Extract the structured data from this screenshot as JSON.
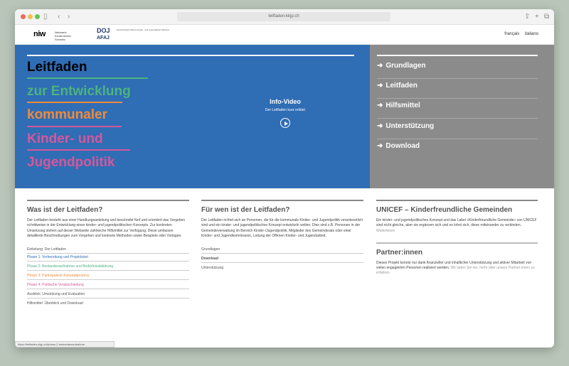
{
  "browser": {
    "url": "leitfaden-kkjp.ch",
    "icons": [
      "sidebar-icon",
      "back-icon",
      "forward-icon",
      "share-icon",
      "new-tab-icon",
      "tabs-icon"
    ]
  },
  "header": {
    "logo_niw": "niw",
    "logo_niw_text": "Netzwerk Kinderrechte Schweiz",
    "logo_doj": "DOJ",
    "logo_doj_sub": "AFAJ",
    "logo_doj_text": "Dachverband Offene Kinder- und Jugendarbeit Schweiz",
    "languages": [
      "français",
      "italiano"
    ]
  },
  "hero": {
    "title_lines": [
      {
        "text": "Leitfaden",
        "color": "#ffffff"
      },
      {
        "text": "zur Entwicklung",
        "color": "#4db37e"
      },
      {
        "text": "kommunaler",
        "color": "#f08a3c"
      },
      {
        "text": "Kinder- und",
        "color": "#d4589a"
      },
      {
        "text": "Jugendpolitik",
        "color": "#d4589a"
      }
    ],
    "video_title": "Info-Video",
    "video_sub": "Der Leitfaden kurz erklärt"
  },
  "nav": {
    "items": [
      "Grundlagen",
      "Leitfaden",
      "Hilfsmittel",
      "Unterstützung",
      "Download"
    ]
  },
  "col1": {
    "heading": "Was ist der Leitfaden?",
    "body": "Der Leitfaden besteht aus einer Handlungsanleitung und beschreibt fünf und orientiert das Vorgehen schrittweise in der Entwicklung eines kinder- und jugendpolitischen Konzepts. Zur konkreten Umsetzung stehen auf dieser Webseite zahlreiche Hilfsmittel zur Verfügung. Diese umfassen detaillierte Beschreibungen zum Vorgehen und konkrete Methoden sowie Beispiele oder Vorlagen.",
    "links": [
      {
        "text": "Einleitung: Der Leitfaden",
        "color": "#555555"
      },
      {
        "text": "Phase 1: Vorbereitung und Projektstart",
        "color": "#2f6db5"
      },
      {
        "text": "Phase 2: Bestandesaufnahme und Bedürfnisabklärung",
        "color": "#4db37e"
      },
      {
        "text": "Phase 3: Partizipativer Konzeptprozess",
        "color": "#f08a3c"
      },
      {
        "text": "Phase 4: Politische Verabschiedung",
        "color": "#d4589a"
      },
      {
        "text": "Ausblick: Umsetzung und Evaluation",
        "color": "#555555"
      },
      {
        "text": "Hilfsmittel: Überblick und Download",
        "color": "#555555"
      }
    ]
  },
  "col2": {
    "heading": "Für wen ist der Leitfaden?",
    "body": "Der Leitfaden richtet sich an Personen, die für die kommunale Kinder- und Jugendpolitik verantwortlich sind und ein kinder- und jugendpolitisches Konzept entwickeln wollen. Dies sind z.B. Personen in der Gemeindeverwaltung im Bereich Kinder-/Jugendpolitik, Mitglieder des Gemeinderats oder einer Kinder- und Jugendkommission, Leitung der Offenen Kinder- und Jugendarbeit.",
    "links": [
      "Grundlagen",
      "Download",
      "Unterstützung"
    ]
  },
  "col3": {
    "heading": "UNICEF – Kinderfreundliche Gemeinden",
    "body": "Ein kinder- und jugendpolitisches Konzept und das Label «Kinderfreundliche Gemeinde» von UNICEF sind nicht gleiche, aber sie ergänzen sich und es lohnt sich, diese miteinander zu verbinden.",
    "body_link": "Weiterlesen",
    "partner_heading": "Partner:innen",
    "partner_body": "Dieses Projekt konnte nur dank finanzieller und inhaltlicher Unterstützung und aktiver Mitarbeit von vielen engagierten Personen realisiert werden.",
    "partner_link": "Wir laden Sie ein, mehr über unsere Partner:innen zu erfahren."
  },
  "status_url": "https://leitfaden-kkjp.ch/phase-2-bestandesaufnahme"
}
